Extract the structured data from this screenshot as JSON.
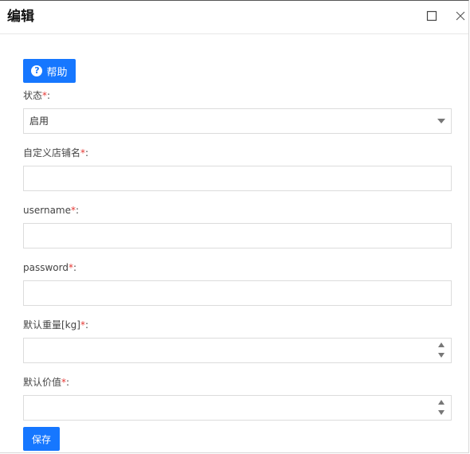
{
  "dialog": {
    "title": "编辑"
  },
  "toolbar": {
    "help_label": "帮助",
    "help_icon": "question-circle-icon"
  },
  "form": {
    "required_mark": "*",
    "colon": ":",
    "status": {
      "label": "状态",
      "value": "启用"
    },
    "shop_name": {
      "label": "自定义店铺名",
      "value": ""
    },
    "username": {
      "label": "username",
      "value": ""
    },
    "password": {
      "label": "password",
      "value": ""
    },
    "default_weight": {
      "label": "默认重量[kg]",
      "value": ""
    },
    "default_value": {
      "label": "默认价值",
      "value": ""
    },
    "save_label": "保存"
  },
  "colors": {
    "primary": "#1677ff",
    "required": "#e53935"
  }
}
